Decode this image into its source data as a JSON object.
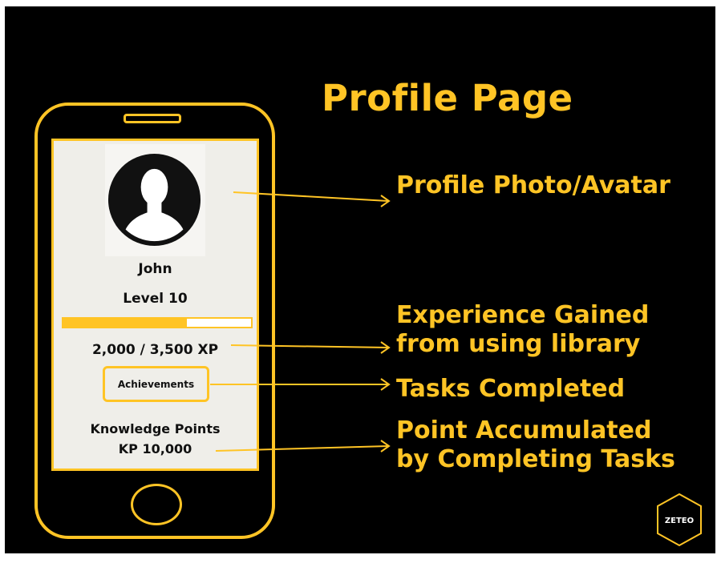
{
  "title": "Profile Page",
  "colors": {
    "accent": "#ffc425",
    "background": "#000000",
    "screen": "#efeee9"
  },
  "phone": {
    "avatar_icon": "person-silhouette-icon",
    "name": "John",
    "level": "Level 10",
    "xp_progress": 0.66,
    "xp_text": "2,000 / 3,500 XP",
    "achievements_label": "Achievements",
    "kp_label": "Knowledge Points",
    "kp_value": "KP 10,000"
  },
  "callouts": {
    "avatar": "Profile Photo/Avatar",
    "experience_line1": "Experience Gained",
    "experience_line2": "from using library",
    "tasks": "Tasks Completed",
    "points_line1": "Point Accumulated",
    "points_line2": "by Completing Tasks"
  },
  "logo": {
    "text": "ZETEO",
    "icon": "hexagon-logo-icon"
  }
}
